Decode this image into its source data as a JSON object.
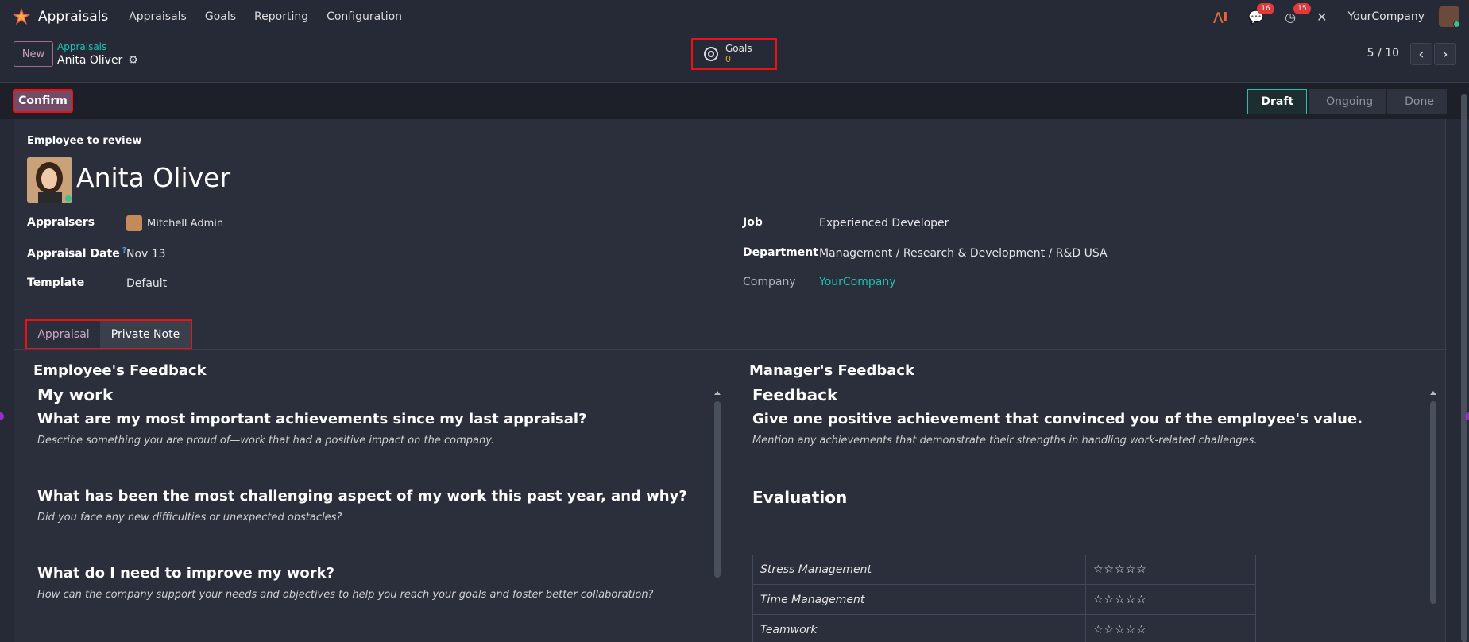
{
  "navbar": {
    "app_name": "Appraisals",
    "menu": [
      "Appraisals",
      "Goals",
      "Reporting",
      "Configuration"
    ],
    "chat_badge": "16",
    "activity_badge": "15",
    "company": "YourCompany"
  },
  "control": {
    "new_label": "New",
    "breadcrumb_parent": "Appraisals",
    "breadcrumb_current": "Anita Oliver",
    "goals_label": "Goals",
    "goals_count": "0",
    "pager": "5 / 10"
  },
  "status": {
    "confirm_label": "Confirm",
    "stages": [
      "Draft",
      "Ongoing",
      "Done"
    ],
    "active_stage": "Draft"
  },
  "employee": {
    "section_label": "Employee to review",
    "name": "Anita Oliver"
  },
  "fields": {
    "appraisers_label": "Appraisers",
    "appraisers_value": "Mitchell Admin",
    "date_label": "Appraisal Date",
    "date_help": "?",
    "date_value": "Nov 13",
    "template_label": "Template",
    "template_value": "Default",
    "job_label": "Job",
    "job_value": "Experienced Developer",
    "department_label": "Department",
    "department_value": "Management / Research & Development / R&D USA",
    "company_label": "Company",
    "company_value": "YourCompany"
  },
  "tabs": {
    "appraisal": "Appraisal",
    "private_note": "Private Note"
  },
  "employee_feedback": {
    "title": "Employee's Feedback",
    "heading": "My work",
    "questions": [
      {
        "q": "What are my most important achievements since my last appraisal?",
        "hint": "Describe something you are proud of—work that had a positive impact on the company."
      },
      {
        "q": "What has been the most challenging aspect of my work this past year, and why?",
        "hint": "Did you face any new difficulties or unexpected obstacles?"
      },
      {
        "q": "What do I need to improve my work?",
        "hint": "How can the company support your needs and objectives to help you reach your goals and foster better collaboration?"
      }
    ]
  },
  "manager_feedback": {
    "title": "Manager's Feedback",
    "heading": "Feedback",
    "question": "Give one positive achievement that convinced you of the employee's value.",
    "hint": "Mention any achievements that demonstrate their strengths in handling work-related challenges.",
    "evaluation_heading": "Evaluation",
    "evaluation_rows": [
      {
        "name": "Stress Management",
        "stars": "☆☆☆☆☆"
      },
      {
        "name": "Time Management",
        "stars": "☆☆☆☆☆"
      },
      {
        "name": "Teamwork",
        "stars": "☆☆☆☆☆"
      }
    ]
  },
  "colors": {
    "accent": "#714b67",
    "link": "#1ec3b1",
    "highlight": "#ee1111"
  }
}
